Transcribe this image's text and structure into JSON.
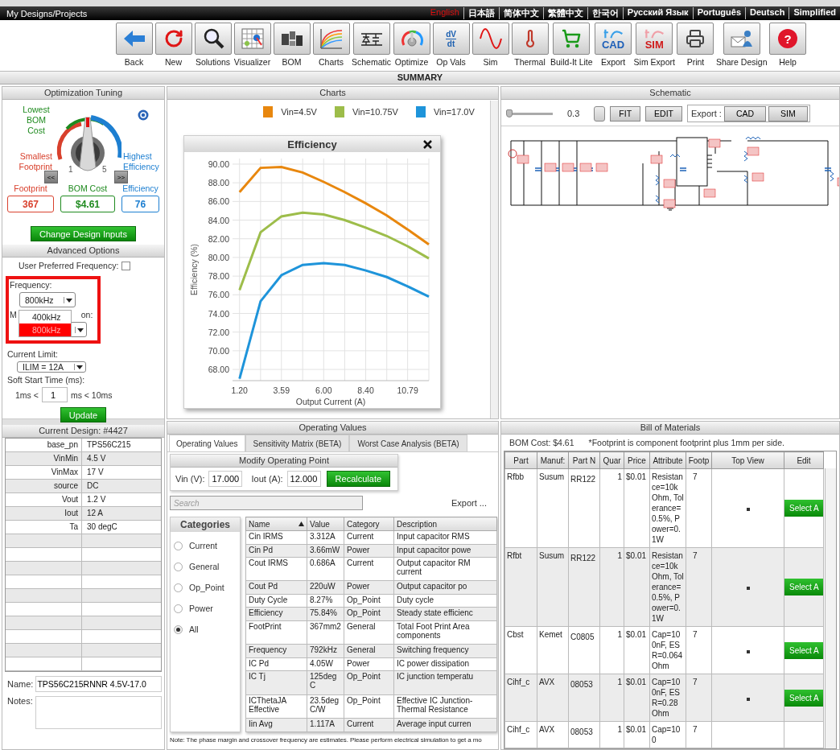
{
  "top_bar": {
    "title": "My Designs/Projects",
    "languages": [
      {
        "label": "English",
        "selected": true
      },
      {
        "label": "日本語",
        "selected": false
      },
      {
        "label": "简体中文",
        "selected": false
      },
      {
        "label": "繁體中文",
        "selected": false
      },
      {
        "label": "한국어",
        "selected": false
      },
      {
        "label": "Русский Язык",
        "selected": false
      },
      {
        "label": "Português",
        "selected": false
      },
      {
        "label": "Deutsch",
        "selected": false
      },
      {
        "label": "Simplified",
        "selected": false
      }
    ]
  },
  "toolbar": [
    {
      "label": "Back"
    },
    {
      "label": "New"
    },
    {
      "label": "Solutions"
    },
    {
      "label": "Visualizer"
    },
    {
      "label": "BOM"
    },
    {
      "label": "Charts"
    },
    {
      "label": "Schematic"
    },
    {
      "label": "Optimize"
    },
    {
      "label": "Op Vals",
      "glyph": [
        "dV",
        "dt"
      ]
    },
    {
      "label": "Sim"
    },
    {
      "label": "Thermal"
    },
    {
      "label": "Build-It Lite"
    },
    {
      "label": "Export",
      "glyph": [
        "CAD"
      ]
    },
    {
      "label": "Sim Export",
      "glyph": [
        "SIM"
      ]
    },
    {
      "label": "Print"
    },
    {
      "label": "Share Design"
    },
    {
      "label": "Help",
      "glyph": [
        "?"
      ]
    }
  ],
  "summary_title": "SUMMARY",
  "optimization": {
    "title": "Optimization Tuning",
    "lowest_label": "Lowest BOM Cost",
    "smallest_label": "Smallest Footprint",
    "highest_label": "Highest Efficiency",
    "scale_min": "1",
    "scale_max": "5",
    "prev_button": "<<",
    "next_button": ">>",
    "metrics": [
      {
        "label": "Footprint",
        "value": "367",
        "color": "#d9412e"
      },
      {
        "label": "BOM Cost",
        "value": "$4.61",
        "color": "#1e8a1e"
      },
      {
        "label": "Efficiency",
        "value": "76",
        "color": "#1d7fd1"
      }
    ],
    "change_button": "Change Design Inputs"
  },
  "advanced": {
    "title": "Advanced Options",
    "preferred_label": "User Preferred Frequency:",
    "preferred_checked": false,
    "frequency_label": "Frequency:",
    "frequency_value": "800kHz",
    "frequency_open": true,
    "frequency_options": [
      {
        "label": "400kHz",
        "selected": false
      },
      {
        "label": "800kHz",
        "selected": true
      }
    ],
    "covered_label_start": "M",
    "covered_label_end": "on:",
    "current_limit_label": "Current Limit:",
    "current_limit_value": "ILIM = 12A",
    "soft_start_label": "Soft Start Time (ms):",
    "soft_start_min": "1ms <",
    "soft_start_value": "1",
    "soft_start_max": "ms < 10ms",
    "update_button": "Update"
  },
  "current_design": {
    "title": "Current Design: #4427",
    "rows": [
      {
        "key": "base_pn",
        "value": "TPS56C215"
      },
      {
        "key": "VinMin",
        "value": "4.5 V"
      },
      {
        "key": "VinMax",
        "value": "17 V"
      },
      {
        "key": "source",
        "value": "DC"
      },
      {
        "key": "Vout",
        "value": "1.2 V"
      },
      {
        "key": "Iout",
        "value": "12 A"
      },
      {
        "key": "Ta",
        "value": "30 degC"
      }
    ],
    "name_label": "Name:",
    "name_value": "TPS56C215RNNR 4.5V-17.0",
    "notes_label": "Notes:"
  },
  "charts": {
    "title": "Charts",
    "chart_data": {
      "type": "line",
      "title": "Efficiency",
      "grid": true,
      "xlabel": "Output Current (A)",
      "ylabel": "Efficiency (%)",
      "x": [
        1.2,
        2.4,
        3.59,
        4.8,
        6.0,
        7.2,
        8.4,
        9.6,
        10.79,
        12.0
      ],
      "series": [
        {
          "name": "Vin=4.5V",
          "color": "#e8870e",
          "values": [
            87.0,
            89.6,
            89.7,
            89.1,
            88.1,
            87.0,
            85.8,
            84.5,
            83.0,
            81.4
          ]
        },
        {
          "name": "Vin=10.75V",
          "color": "#9dbd4a",
          "values": [
            76.5,
            82.7,
            84.4,
            84.8,
            84.6,
            84.0,
            83.2,
            82.3,
            81.2,
            79.9
          ]
        },
        {
          "name": "Vin=17.0V",
          "color": "#1e94da",
          "values": [
            67.0,
            75.3,
            78.1,
            79.2,
            79.4,
            79.2,
            78.6,
            77.9,
            76.9,
            75.8
          ]
        }
      ],
      "xlim": [
        0.8,
        12.0
      ],
      "ylim": [
        66.8,
        90.6
      ],
      "xticks": [
        {
          "value": 1.2,
          "label": "1.20"
        },
        {
          "value": 3.59,
          "label": "3.59"
        },
        {
          "value": 6.0,
          "label": "6.00"
        },
        {
          "value": 8.4,
          "label": "8.40"
        },
        {
          "value": 10.79,
          "label": "10.79"
        }
      ],
      "yticks": [
        {
          "value": 68,
          "label": "68.00"
        },
        {
          "value": 70,
          "label": "70.00"
        },
        {
          "value": 72,
          "label": "72.00"
        },
        {
          "value": 74,
          "label": "74.00"
        },
        {
          "value": 76,
          "label": "76.00"
        },
        {
          "value": 78,
          "label": "78.00"
        },
        {
          "value": 80,
          "label": "80.00"
        },
        {
          "value": 82,
          "label": "82.00"
        },
        {
          "value": 84,
          "label": "84.00"
        },
        {
          "value": 86,
          "label": "86.00"
        },
        {
          "value": 88,
          "label": "88.00"
        },
        {
          "value": 90,
          "label": "90.00"
        }
      ]
    }
  },
  "schematic": {
    "title": "Schematic",
    "zoom": {
      "level": 0
    },
    "zoom_value": "0.3",
    "fit_button": "FIT",
    "edit_button": "EDIT",
    "export_label": "Export :",
    "export_buttons": [
      "CAD",
      "SIM"
    ]
  },
  "operating_values": {
    "title": "Operating Values",
    "tabs": [
      {
        "label": "Operating Values",
        "selected": true
      },
      {
        "label": "Sensitivity Matrix (BETA)",
        "selected": false
      },
      {
        "label": "Worst Case Analysis (BETA)",
        "selected": false
      }
    ],
    "modify_title": "Modify Operating Point",
    "vin_label": "Vin (V):",
    "vin_value": "17.000",
    "iout_label": "Iout (A):",
    "iout_value": "12.000",
    "recalculate_button": "Recalculate",
    "search_placeholder": "Search",
    "export_link": "Export ...",
    "categories_title": "Categories",
    "categories": [
      {
        "label": "Current",
        "selected": false
      },
      {
        "label": "General",
        "selected": false
      },
      {
        "label": "Op_Point",
        "selected": false
      },
      {
        "label": "Power",
        "selected": false
      },
      {
        "label": "All",
        "selected": true
      }
    ],
    "columns": [
      {
        "label": "Name",
        "sorted": true
      },
      {
        "label": "Value",
        "sorted": false
      },
      {
        "label": "Category",
        "sorted": false
      },
      {
        "label": "Description",
        "sorted": false
      }
    ],
    "rows": [
      [
        "Cin IRMS",
        "3.312A",
        "Current",
        "Input capacitor RMS"
      ],
      [
        "Cin Pd",
        "3.66mW",
        "Power",
        "Input capacitor powe"
      ],
      [
        "Cout IRMS",
        "0.686A",
        "Current",
        "Output capacitor RM current"
      ],
      [
        "Cout Pd",
        "220uW",
        "Power",
        "Output capacitor po"
      ],
      [
        "Duty Cycle",
        "8.27%",
        "Op_Point",
        "Duty cycle"
      ],
      [
        "Efficiency",
        "75.84%",
        "Op_Point",
        "Steady state efficienc"
      ],
      [
        "FootPrint",
        "367mm2",
        "General",
        "Total Foot Print Area components"
      ],
      [
        "Frequency",
        "792kHz",
        "General",
        "Switching frequency"
      ],
      [
        "IC Pd",
        "4.05W",
        "Power",
        "IC power dissipation"
      ],
      [
        "IC Tj",
        "125degC",
        "Op_Point",
        "IC junction temperatu"
      ],
      [
        "ICThetaJA Effective",
        "23.5degC/W",
        "Op_Point",
        "Effective IC Junction- Thermal Resistance"
      ],
      [
        "Iin Avg",
        "1.117A",
        "Current",
        "Average input curren"
      ]
    ],
    "note": "Note: The phase margin and crossover frequency are estimates.  Please perform electrical simulation to get a mo"
  },
  "bom": {
    "title": "Bill of Materials",
    "cost": "BOM Cost: $4.61",
    "footnote": "*Footprint is component footprint plus 1mm per side.",
    "columns": [
      "Part",
      "Manuf:",
      "Part N",
      "Quar",
      "Price",
      "Attribute",
      "Footp",
      "Top View",
      "Edit"
    ],
    "rows": [
      {
        "part": "Rfbb",
        "manufacturer": "Susum",
        "part_number": "RR122",
        "quantity": "1",
        "price": "$0.01",
        "attribute": "Resistance=10kOhm, Tolerance=0.5%, Power=0.1W",
        "footprint": "7",
        "edit_button": "Select A"
      },
      {
        "part": "Rfbt",
        "manufacturer": "Susum",
        "part_number": "RR122",
        "quantity": "1",
        "price": "$0.01",
        "attribute": "Resistance=10kOhm, Tolerance=0.5%, Power=0.1W",
        "footprint": "7",
        "edit_button": "Select A"
      },
      {
        "part": "Cbst",
        "manufacturer": "Kemet",
        "part_number": "C0805",
        "quantity": "1",
        "price": "$0.01",
        "attribute": "Cap=100nF, ESR=0.064Ohm",
        "footprint": "7",
        "edit_button": "Select A"
      },
      {
        "part": "Cihf_c",
        "manufacturer": "AVX",
        "part_number": "08053",
        "quantity": "1",
        "price": "$0.01",
        "attribute": "Cap=100nF, ESR=0.28Ohm",
        "footprint": "7",
        "edit_button": "Select A"
      },
      {
        "part": "Cihf_c",
        "manufacturer": "AVX",
        "part_number": "08053",
        "quantity": "1",
        "price": "$0.01",
        "attribute": "Cap=100",
        "footprint": "7"
      }
    ]
  }
}
